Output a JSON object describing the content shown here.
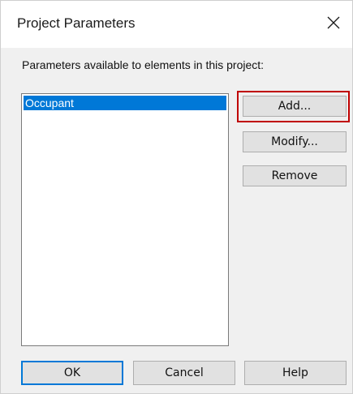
{
  "window": {
    "title": "Project Parameters",
    "close_icon": "close-icon"
  },
  "main": {
    "prompt": "Parameters available to elements in this project:",
    "parameters": [
      {
        "label": "Occupant",
        "selected": true
      }
    ]
  },
  "actions": {
    "add_label": "Add...",
    "modify_label": "Modify...",
    "remove_label": "Remove",
    "highlighted": "Add...",
    "highlight_color": "#c00000"
  },
  "footer": {
    "ok_label": "OK",
    "cancel_label": "Cancel",
    "help_label": "Help"
  },
  "colors": {
    "selection": "#0078d7",
    "dialog_background": "#f0f0f0"
  }
}
